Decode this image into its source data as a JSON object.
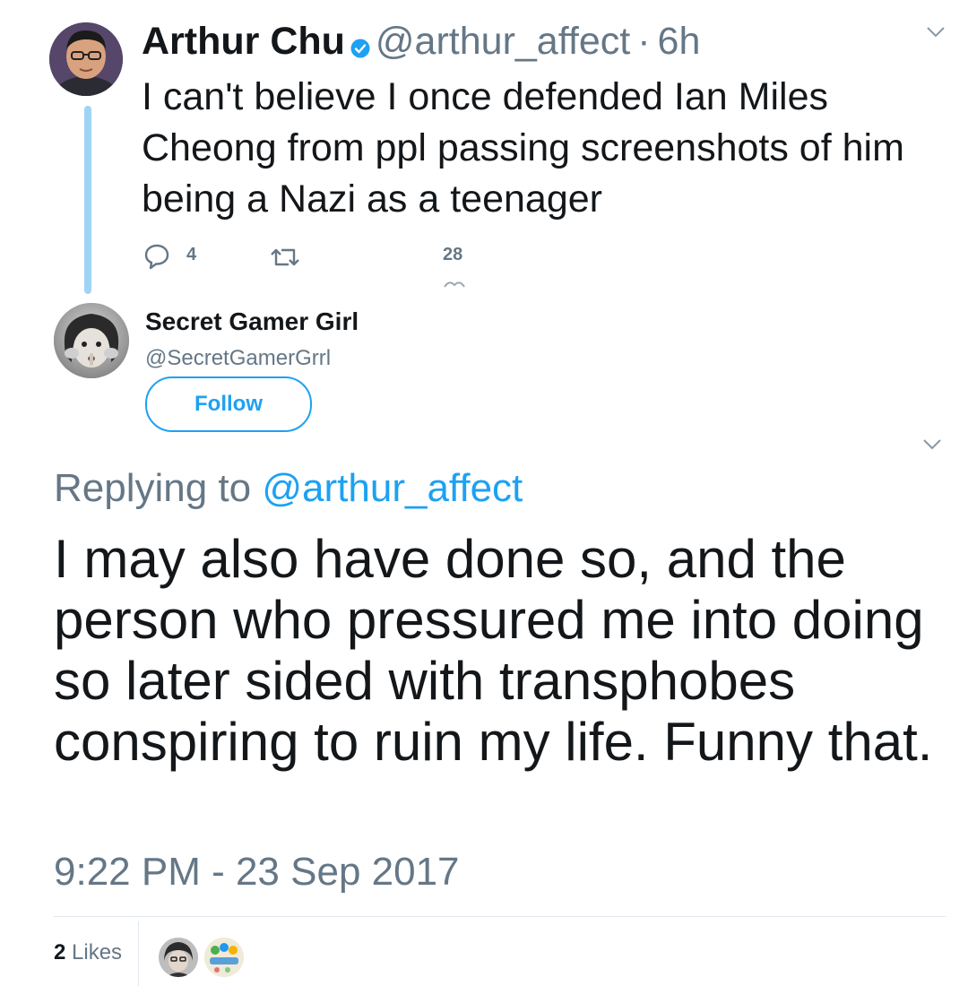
{
  "parent_tweet": {
    "author_name": "Arthur Chu",
    "handle": "@arthur_affect",
    "separator": "·",
    "time": "6h",
    "text": "I can't believe I once defended Ian Miles Cheong from ppl passing screenshots of him being a Nazi as a teenager",
    "reply_count": "4",
    "like_count": "28",
    "verified": true
  },
  "reply_tweet": {
    "author_name": "Secret Gamer Girl",
    "handle": "@SecretGamerGrrl",
    "follow_label": "Follow",
    "replying_prefix": "Replying to",
    "replying_to": "@arthur_affect",
    "text": "I may also have done so, and the person who pressured me into doing so later sided with transphobes conspiring to ruin my life. Funny that.",
    "date": "9:22 PM - 23 Sep 2017",
    "likes_count": "2",
    "likes_label": "Likes"
  },
  "icons": {
    "verified": "verified-badge-icon",
    "caret": "chevron-down-icon",
    "reply": "reply-icon",
    "retweet": "retweet-icon"
  },
  "colors": {
    "accent": "#1da1f2",
    "thread_line": "#9fd4f5",
    "muted_text": "#657786",
    "primary_text": "#14171a"
  }
}
